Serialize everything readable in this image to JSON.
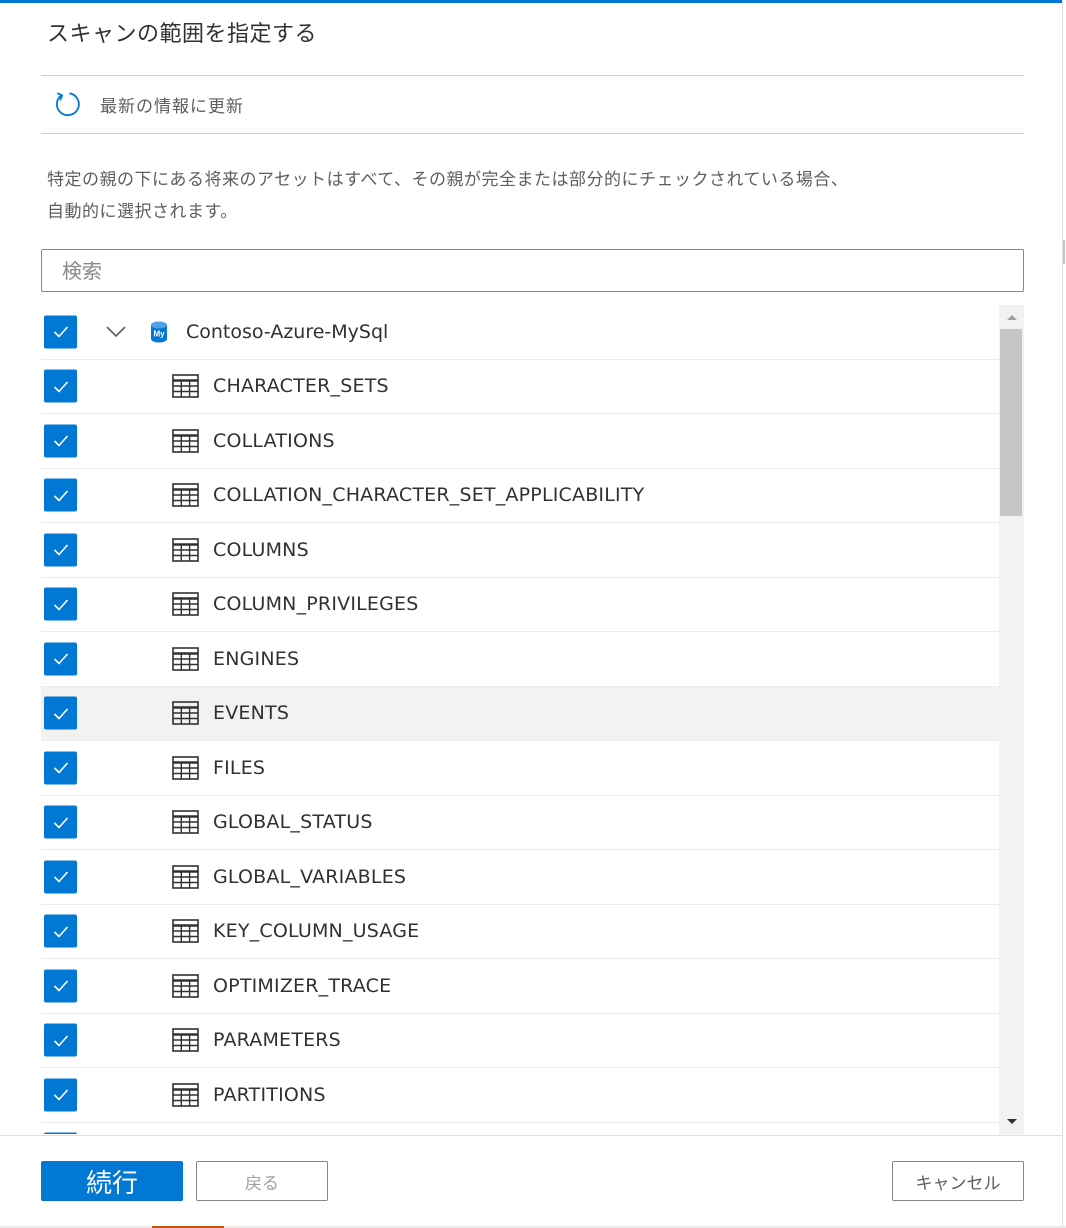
{
  "panel": {
    "title": "スキャンの範囲を指定する",
    "refresh_label": "最新の情報に更新",
    "refresh_icon": "refresh-icon",
    "description_line1": "特定の親の下にある将来のアセットはすべて、その親が完全または部分的にチェックされている場合、",
    "description_line2": "自動的に選択されます。"
  },
  "search": {
    "placeholder": "検索",
    "value": ""
  },
  "tree": {
    "root": {
      "label": "Contoso-Azure-MySql",
      "icon": "mysql-database-icon",
      "icon_text": "My",
      "checked": true,
      "expanded": true
    },
    "items": [
      {
        "label": "CHARACTER_SETS",
        "checked": true
      },
      {
        "label": "COLLATIONS",
        "checked": true
      },
      {
        "label": "COLLATION_CHARACTER_SET_APPLICABILITY",
        "checked": true
      },
      {
        "label": "COLUMNS",
        "checked": true
      },
      {
        "label": "COLUMN_PRIVILEGES",
        "checked": true
      },
      {
        "label": "ENGINES",
        "checked": true
      },
      {
        "label": "EVENTS",
        "checked": true,
        "hovered": true
      },
      {
        "label": "FILES",
        "checked": true
      },
      {
        "label": "GLOBAL_STATUS",
        "checked": true
      },
      {
        "label": "GLOBAL_VARIABLES",
        "checked": true
      },
      {
        "label": "KEY_COLUMN_USAGE",
        "checked": true
      },
      {
        "label": "OPTIMIZER_TRACE",
        "checked": true
      },
      {
        "label": "PARAMETERS",
        "checked": true
      },
      {
        "label": "PARTITIONS",
        "checked": true
      },
      {
        "label": "",
        "checked": true
      }
    ]
  },
  "scroll": {
    "position_fraction": 0.0,
    "visible_fraction": 0.24
  },
  "footer": {
    "continue_label": "続行",
    "back_label": "戻る",
    "cancel_label": "キャンセル"
  },
  "colors": {
    "accent": "#0078d4",
    "text": "#323130",
    "secondary_text": "#605e5c",
    "hover_row": "#f3f2f1"
  }
}
